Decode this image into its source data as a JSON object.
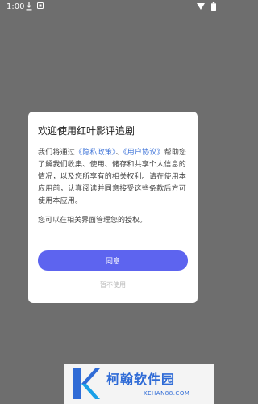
{
  "status_bar": {
    "time": "1:00"
  },
  "dialog": {
    "title": "欢迎使用红叶影评追剧",
    "body_prefix": "我们将通过",
    "privacy_link": "《隐私政策》",
    "separator": "、",
    "terms_link": "《用户协议》",
    "body_suffix": "帮助您了解我们收集、使用、储存和共享个人信息的情况，以及您所享有的相关权利。请在使用本应用前，认真阅读并同意接受这些条款后方可使用本应用。",
    "note": "您可以在相关界面管理您的授权。",
    "agree_label": "同意",
    "decline_label": "暂不使用"
  },
  "watermark": {
    "name": "柯翰软件园",
    "url": "KEHAN88.COM"
  },
  "colors": {
    "accent": "#5d64ef",
    "link": "#3f74d8",
    "overlay": "#6e6e6e"
  }
}
